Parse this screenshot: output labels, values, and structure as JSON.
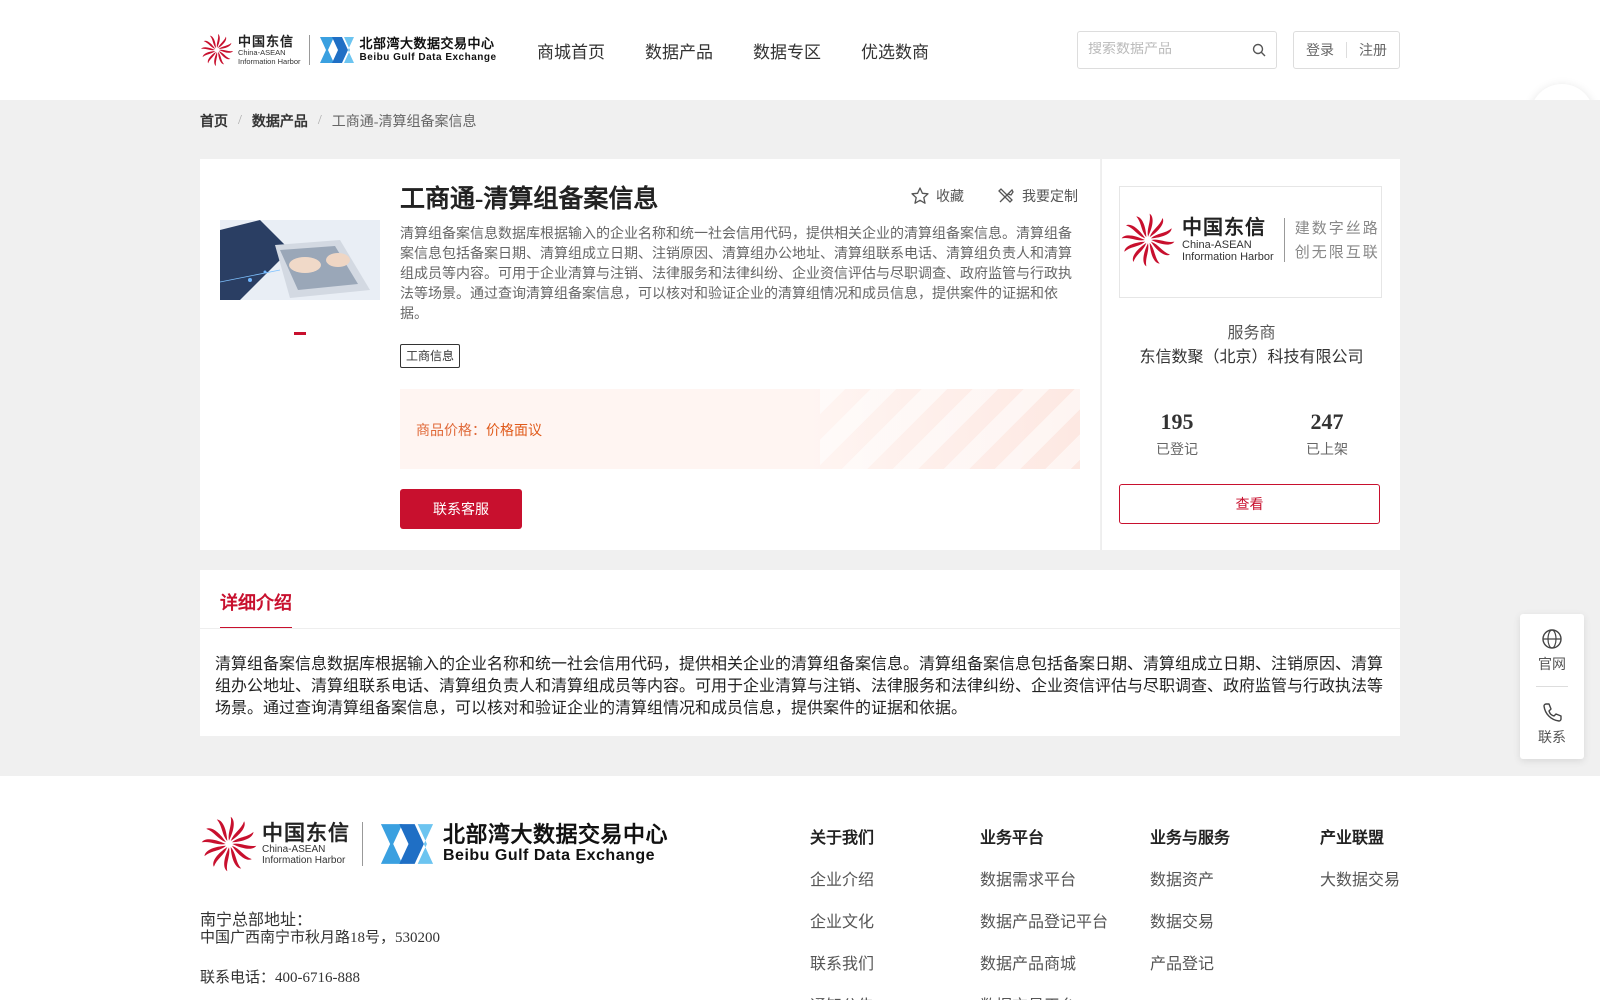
{
  "header": {
    "logo_cn": "中国东信",
    "logo_en1": "China-ASEAN",
    "logo_en2": "Information Harbor",
    "logo2_cn": "北部湾大数据交易中心",
    "logo2_en": "Beibu Gulf Data Exchange",
    "nav": [
      "商城首页",
      "数据产品",
      "数据专区",
      "优选数商"
    ],
    "search_placeholder": "搜索数据产品",
    "login": "登录",
    "register": "注册"
  },
  "breadcrumb": {
    "home": "首页",
    "products": "数据产品",
    "current": "工商通-清算组备案信息"
  },
  "product": {
    "title": "工商通-清算组备案信息",
    "favorite": "收藏",
    "customize": "我要定制",
    "description": "清算组备案信息数据库根据输入的企业名称和统一社会信用代码，提供相关企业的清算组备案信息。清算组备案信息包括备案日期、清算组成立日期、注销原因、清算组办公地址、清算组联系电话、清算组负责人和清算组成员等内容。可用于企业清算与注销、法律服务和法律纠纷、企业资信评估与尽职调查、政府监管与行政执法等场景。通过查询清算组备案信息，可以核对和验证企业的清算组情况和成员信息，提供案件的证据和依据。",
    "tag": "工商信息",
    "price_label": "商品价格：",
    "price_value": "价格面议",
    "contact_button": "联系客服"
  },
  "provider": {
    "logo_cn": "中国东信",
    "logo_en1": "China-ASEAN",
    "logo_en2": "Information Harbor",
    "slogan1": "建数字丝路",
    "slogan2": "创无限互联",
    "label": "服务商",
    "name": "东信数聚（北京）科技有限公司",
    "registered_count": "195",
    "registered_label": "已登记",
    "listed_count": "247",
    "listed_label": "已上架",
    "view_button": "查看"
  },
  "detail": {
    "tab": "详细介绍",
    "text": "清算组备案信息数据库根据输入的企业名称和统一社会信用代码，提供相关企业的清算组备案信息。清算组备案信息包括备案日期、清算组成立日期、注销原因、清算组办公地址、清算组联系电话、清算组负责人和清算组成员等内容。可用于企业清算与注销、法律服务和法律纠纷、企业资信评估与尽职调查、政府监管与行政执法等场景。通过查询清算组备案信息，可以核对和验证企业的清算组情况和成员信息，提供案件的证据和依据。"
  },
  "side": {
    "website": "官网",
    "contact": "联系"
  },
  "footer": {
    "address_label": "南宁总部地址：",
    "address": "中国广西南宁市秋月路18号，530200",
    "phone": "联系电话：400-6716-888",
    "columns": [
      {
        "title": "关于我们",
        "links": [
          "企业介绍",
          "企业文化",
          "联系我们",
          "通知公告"
        ]
      },
      {
        "title": "业务平台",
        "links": [
          "数据需求平台",
          "数据产品登记平台",
          "数据产品商城",
          "数据交易平台"
        ]
      },
      {
        "title": "业务与服务",
        "links": [
          "数据资产",
          "数据交易",
          "产品登记"
        ]
      },
      {
        "title": "产业联盟",
        "links": [
          "大数据交易"
        ]
      }
    ]
  },
  "colors": {
    "brand_red": "#c8102e",
    "brand_blue": "#1f6fc5",
    "price_orange": "#e05a1a"
  }
}
